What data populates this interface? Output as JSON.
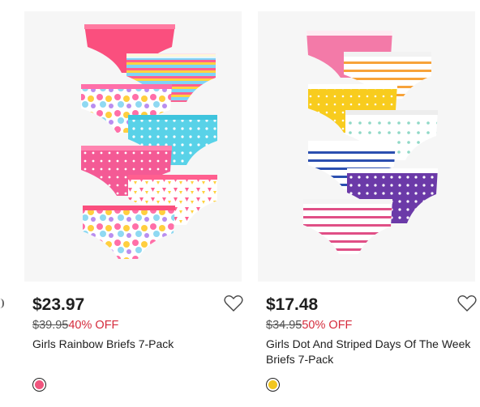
{
  "products": [
    {
      "price": "$23.97",
      "was_price": "$39.95",
      "discount": "40% OFF",
      "title": "Girls Rainbow Briefs 7-Pack",
      "swatch_color": "#f0557e",
      "image_icon": "rainbow-briefs-7-pack-image",
      "favorite_icon": "heart-outline-icon"
    },
    {
      "price": "$17.48",
      "was_price": "$34.95",
      "discount": "50% OFF",
      "title": "Girls Dot And Striped Days Of The Week Briefs 7-Pack",
      "swatch_color": "#f2c61d",
      "image_icon": "dot-striped-briefs-7-pack-image",
      "favorite_icon": "heart-outline-icon"
    }
  ],
  "colors": {
    "discount": "#d52b3c",
    "price": "#1f1f1f"
  }
}
